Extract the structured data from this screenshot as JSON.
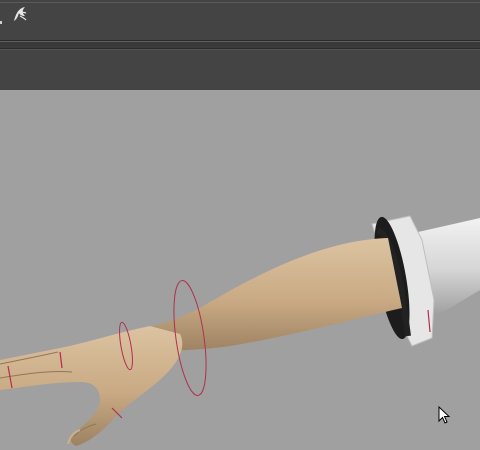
{
  "app": {
    "icon": "maya-logo-icon"
  },
  "viewport": {
    "background": "#a0a0a0",
    "controls_color": "#b03050",
    "arm_color": "#cdb08c",
    "sleeve_color": "#d8d8d8"
  },
  "cursor": {
    "icon": "mouse-pointer-icon"
  }
}
